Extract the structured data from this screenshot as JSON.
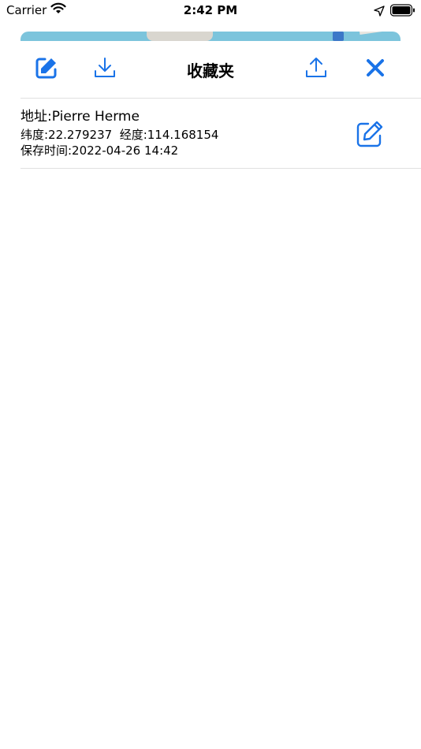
{
  "status_bar": {
    "carrier": "Carrier",
    "time": "2:42 PM"
  },
  "toolbar": {
    "title": "收藏夹"
  },
  "favorites": [
    {
      "address": "地址:Pierre Herme",
      "coordinates": "纬度:22.279237  经度:114.168154",
      "saved_time": "保存时间:2022-04-26 14:42"
    }
  ],
  "colors": {
    "accent": "#1a73e8",
    "map_water": "#7cc4dc",
    "divider": "#e0e0e0"
  }
}
